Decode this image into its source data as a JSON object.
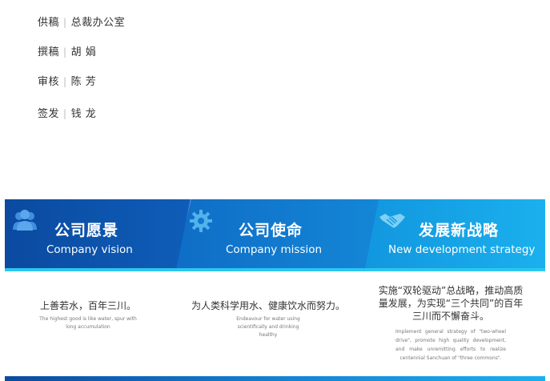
{
  "credits": [
    {
      "label": "供稿",
      "separator": "|",
      "value": "总裁办公室"
    },
    {
      "label": "撰稿",
      "separator": "|",
      "value": "胡 娟"
    },
    {
      "label": "审核",
      "separator": "|",
      "value": "陈 芳"
    },
    {
      "label": "签发",
      "separator": "|",
      "value": "钱 龙"
    }
  ],
  "banner": {
    "panels": [
      {
        "title": "公司愿景",
        "subtitle": "Company vision",
        "icon": "people-icon"
      },
      {
        "title": "公司使命",
        "subtitle": "Company mission",
        "icon": "gear-icon"
      },
      {
        "title": "发展新战略",
        "subtitle": "New development strategy",
        "icon": "handshake-icon"
      }
    ]
  },
  "columns": [
    {
      "cn": "上善若水，百年三川。",
      "en": "The highest good is like water, spur with long accumulation"
    },
    {
      "cn": "为人类科学用水、健康饮水而努力。",
      "en": "Endeavour for water using scientifically and drinking healthy"
    },
    {
      "cn": "实施“双轮驱动”总战略，推动高质量发展，为实现“三个共同”的百年三川而不懈奋斗。",
      "en": "Implement general strategy of \"two-wheel drive\", promote high quality development, and make unremitting efforts to realize centennial Sanchuan of \"three commons\"."
    }
  ],
  "colors": {
    "dark_blue": "#0b4aa0",
    "mid_blue": "#1486d6",
    "light_blue": "#1ab0ee",
    "strip": "#2ec6ee"
  }
}
